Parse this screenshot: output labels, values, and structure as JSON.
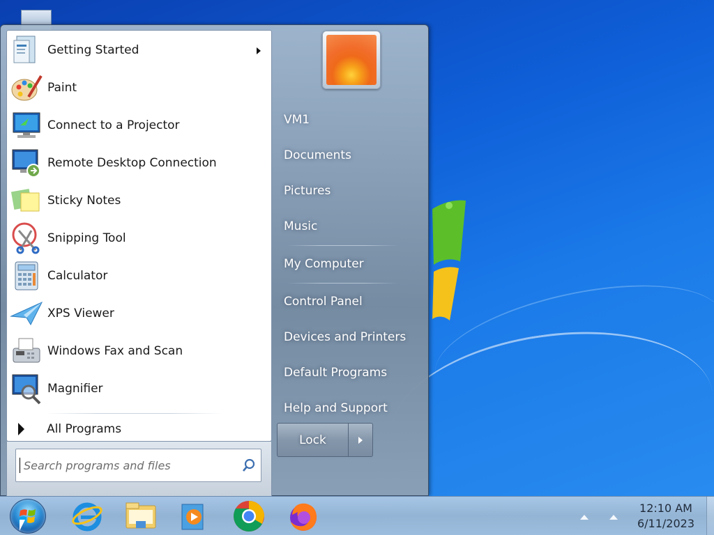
{
  "start_menu": {
    "programs": [
      {
        "label": "Getting Started",
        "icon": "getting-started-icon",
        "submenu": true
      },
      {
        "label": "Paint",
        "icon": "paint-icon"
      },
      {
        "label": "Connect to a Projector",
        "icon": "projector-icon"
      },
      {
        "label": "Remote Desktop Connection",
        "icon": "remote-desktop-icon"
      },
      {
        "label": "Sticky Notes",
        "icon": "sticky-notes-icon"
      },
      {
        "label": "Snipping Tool",
        "icon": "snipping-tool-icon"
      },
      {
        "label": "Calculator",
        "icon": "calculator-icon"
      },
      {
        "label": "XPS Viewer",
        "icon": "xps-viewer-icon"
      },
      {
        "label": "Windows Fax and Scan",
        "icon": "fax-scan-icon"
      },
      {
        "label": "Magnifier",
        "icon": "magnifier-icon"
      }
    ],
    "all_programs_label": "All Programs",
    "search_placeholder": "Search programs and files",
    "right_links": [
      {
        "label": "VM1"
      },
      {
        "label": "Documents"
      },
      {
        "label": "Pictures"
      },
      {
        "label": "Music"
      },
      {
        "label": "My Computer"
      },
      {
        "label": "Control Panel"
      },
      {
        "label": "Devices and Printers"
      },
      {
        "label": "Default Programs"
      },
      {
        "label": "Help and Support"
      }
    ],
    "lock_label": "Lock"
  },
  "taskbar": {
    "pinned": [
      {
        "name": "internet-explorer-icon"
      },
      {
        "name": "file-explorer-icon"
      },
      {
        "name": "media-player-icon"
      },
      {
        "name": "chrome-icon"
      },
      {
        "name": "firefox-icon"
      }
    ],
    "clock": {
      "time": "12:10 AM",
      "date": "6/11/2023"
    }
  },
  "colors": {
    "desktop": "#1b7ae8",
    "menu_frame": "#8a9cb0",
    "text_dark": "#1a1a1a"
  }
}
